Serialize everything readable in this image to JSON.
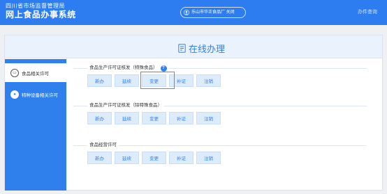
{
  "header": {
    "org": "四川省市场监督管理局",
    "system": "网上食品办事系统",
    "user": "乐山市华正食品厂 关闭",
    "progress_link": "办件查询"
  },
  "card": {
    "title": "在线办理"
  },
  "sidebar": {
    "items": [
      {
        "label": "食品相关许可",
        "active": true
      },
      {
        "label": "特种设备相关许可",
        "active": false
      }
    ]
  },
  "sections": [
    {
      "label": "食品生产许可证核发（特殊食品）",
      "buttons": [
        "新办",
        "延续",
        "变更",
        "补证",
        "注销"
      ]
    },
    {
      "label": "食品生产许可证核发（除特殊食品）",
      "buttons": [
        "新办",
        "延续",
        "变更",
        "补证",
        "注销"
      ]
    },
    {
      "label": "食品经营许可",
      "buttons": [
        "新办",
        "延续",
        "变更",
        "补证",
        "注销"
      ]
    }
  ],
  "colors": {
    "primary": "#2d7df0",
    "highlight": "#e55b5b"
  }
}
